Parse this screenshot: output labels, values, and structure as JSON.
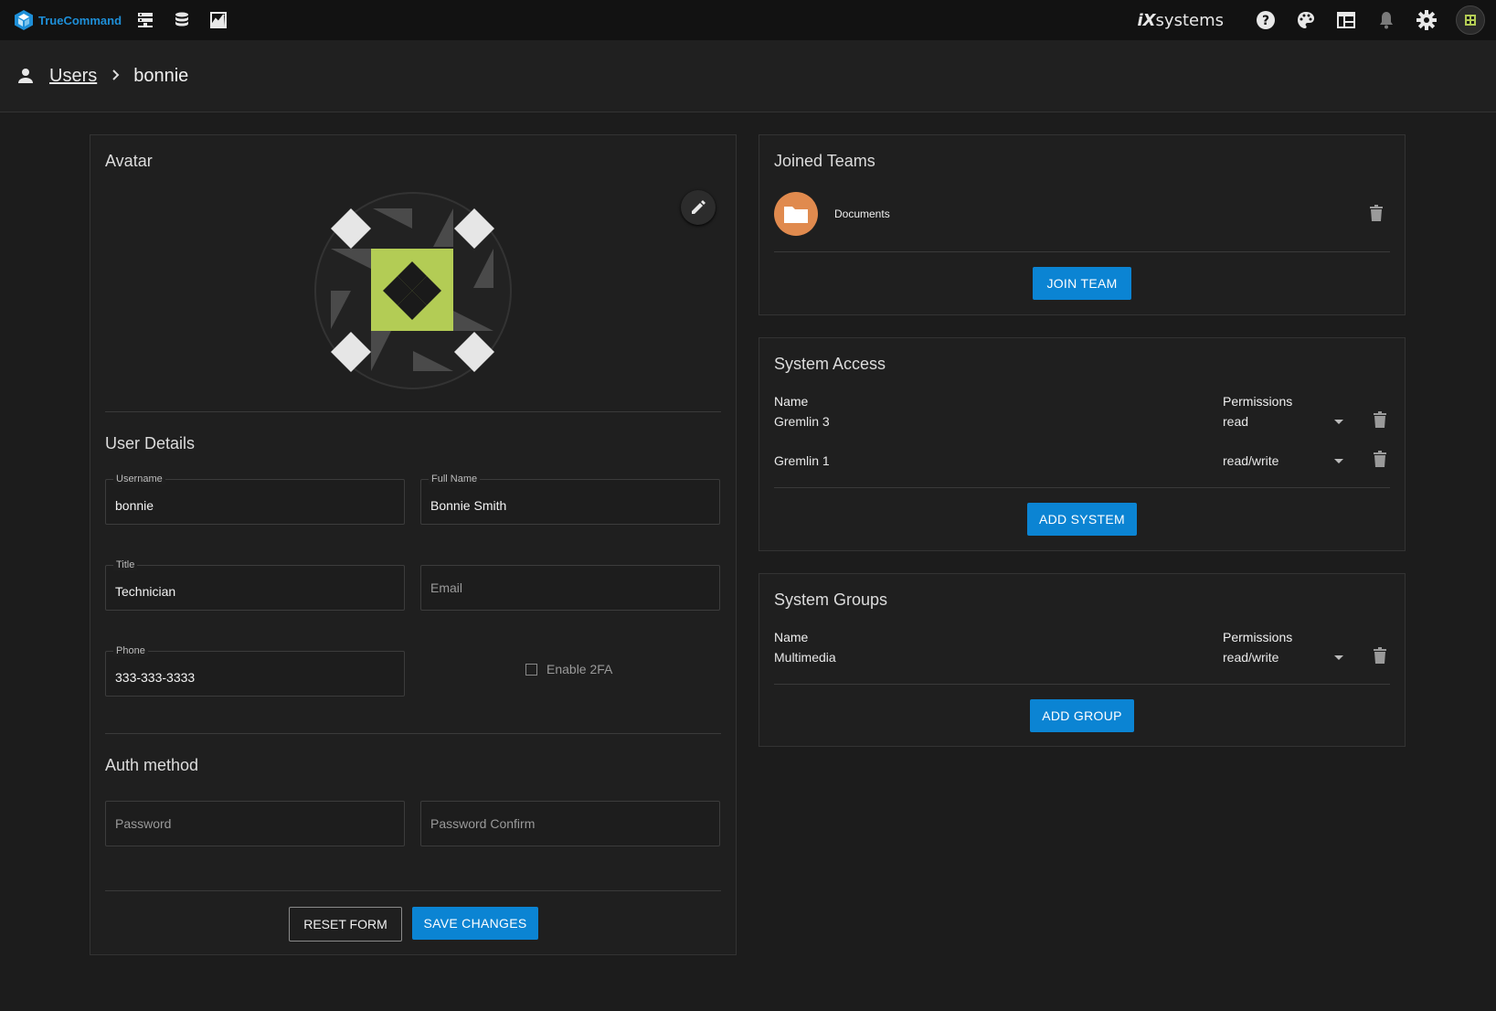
{
  "topbar": {
    "brand": "TrueCommand",
    "vendor_prefix": "iX",
    "vendor_suffix": "systems"
  },
  "breadcrumb": {
    "parent": "Users",
    "current": "bonnie"
  },
  "avatar_panel": {
    "title": "Avatar",
    "identicon_color": "#b3cc55"
  },
  "user_details": {
    "title": "User Details",
    "username_label": "Username",
    "username": "bonnie",
    "fullname_label": "Full Name",
    "fullname": "Bonnie Smith",
    "title_label": "Title",
    "title_value": "Technician",
    "email_placeholder": "Email",
    "phone_label": "Phone",
    "phone": "333-333-3333",
    "twofa_label": "Enable 2FA"
  },
  "auth": {
    "title": "Auth method",
    "password_placeholder": "Password",
    "password_confirm_placeholder": "Password Confirm"
  },
  "form_actions": {
    "reset": "RESET FORM",
    "save": "SAVE CHANGES"
  },
  "teams": {
    "title": "Joined Teams",
    "items": [
      {
        "name": "Documents",
        "icon": "folder-icon",
        "color": "#e08a4e"
      }
    ],
    "join_button": "JOIN TEAM"
  },
  "system_access": {
    "title": "System Access",
    "col_name": "Name",
    "col_permissions": "Permissions",
    "rows": [
      {
        "name": "Gremlin 3",
        "permission": "read"
      },
      {
        "name": "Gremlin 1",
        "permission": "read/write"
      }
    ],
    "add_button": "ADD SYSTEM"
  },
  "system_groups": {
    "title": "System Groups",
    "col_name": "Name",
    "col_permissions": "Permissions",
    "rows": [
      {
        "name": "Multimedia",
        "permission": "read/write"
      }
    ],
    "add_button": "ADD GROUP"
  },
  "colors": {
    "accent": "#0b84d3",
    "background": "#1c1c1c",
    "topbar": "#121212"
  }
}
